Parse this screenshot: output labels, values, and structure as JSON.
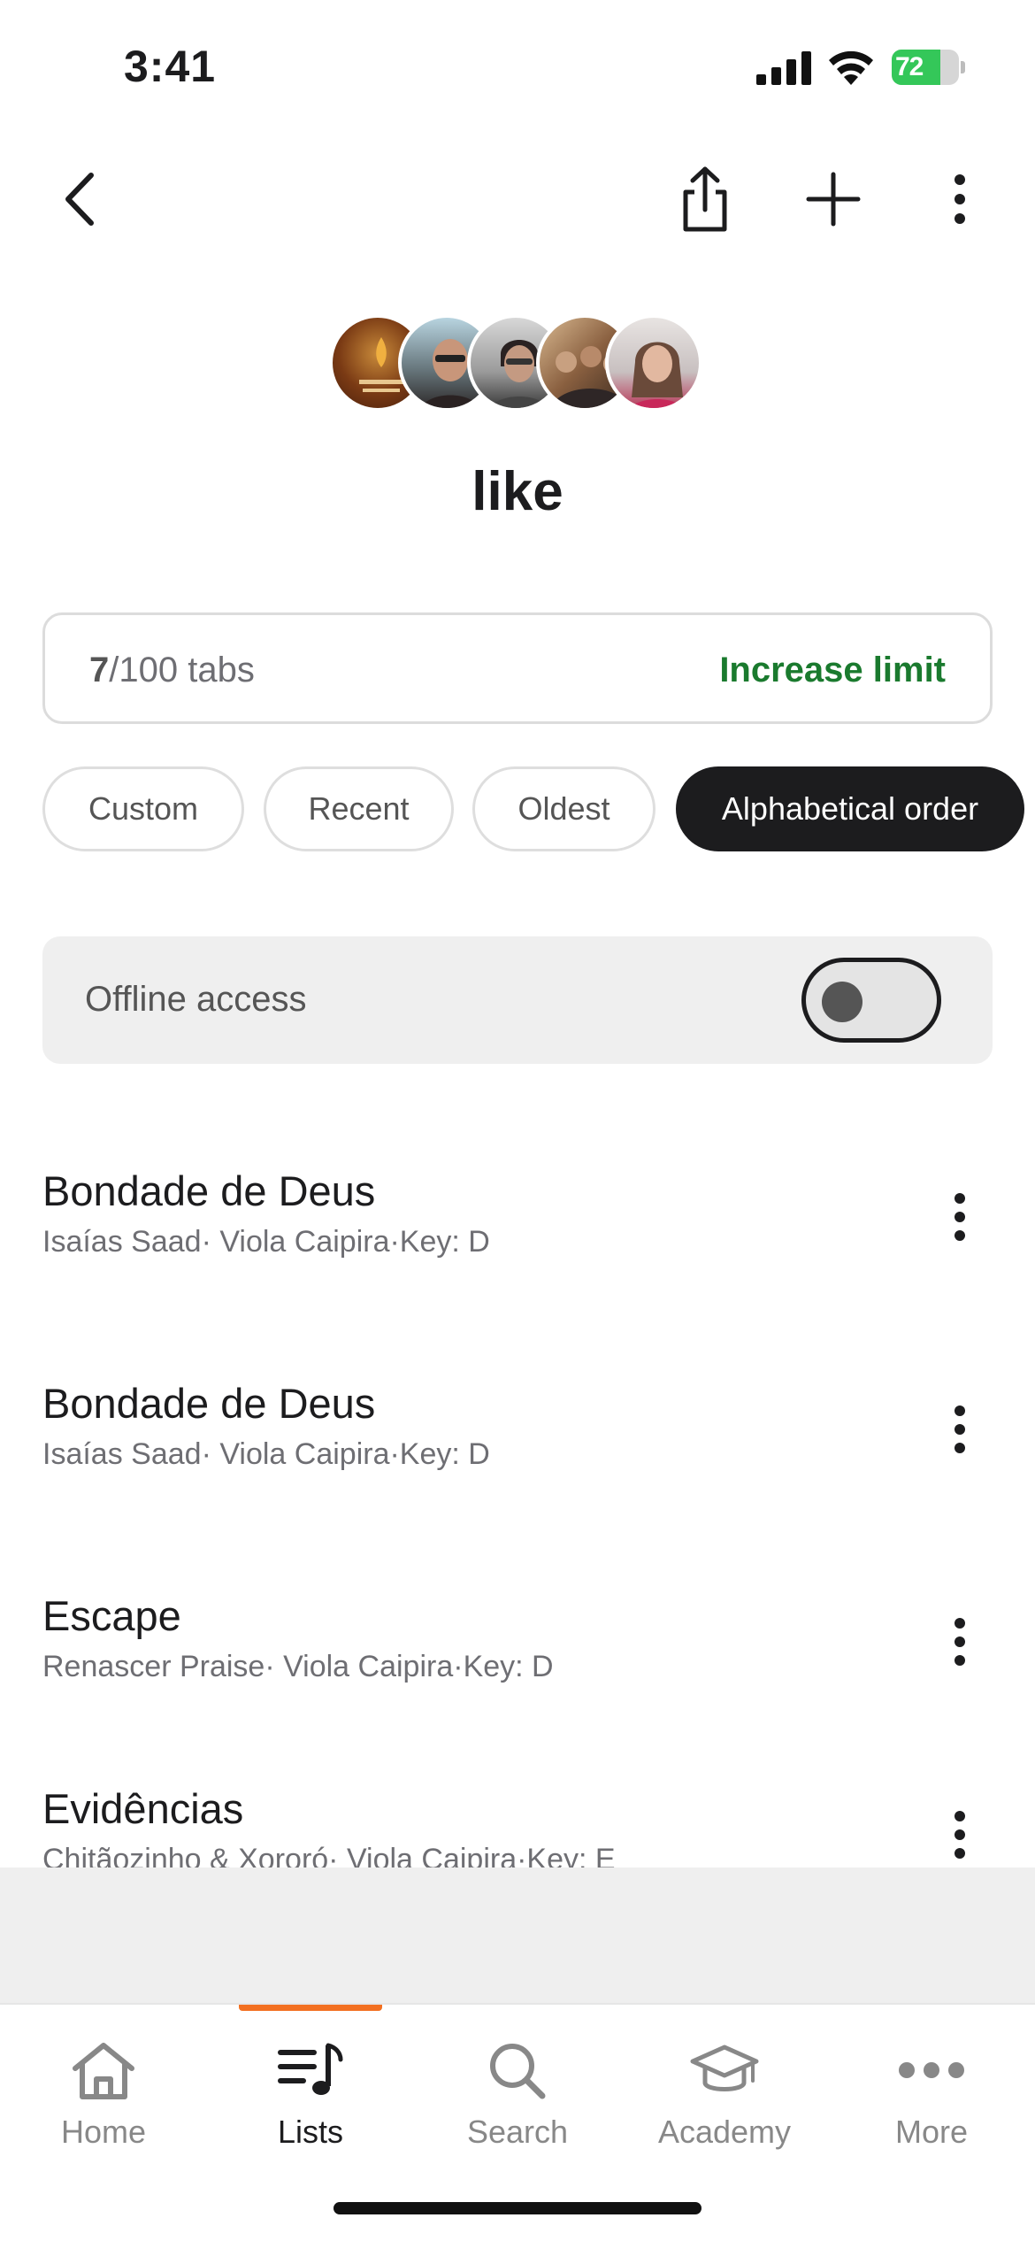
{
  "status_bar": {
    "time": "3:41",
    "battery_level": "72",
    "battery_fraction": 0.72,
    "icons": [
      "signal-icon",
      "wifi-icon",
      "battery-icon"
    ]
  },
  "top_bar": {
    "icons": [
      "back-icon",
      "share-icon",
      "add-icon",
      "more-vertical-icon"
    ]
  },
  "list": {
    "title": "like",
    "avatar_count": 5
  },
  "limit": {
    "current": "7",
    "max_suffix": "/100 tabs",
    "increase_label": "Increase limit",
    "accent_color": "#1a7a2e"
  },
  "sort_options": [
    {
      "label": "Custom",
      "selected": false
    },
    {
      "label": "Recent",
      "selected": false
    },
    {
      "label": "Oldest",
      "selected": false
    },
    {
      "label": "Alphabetical order",
      "selected": true
    }
  ],
  "offline": {
    "label": "Offline access",
    "enabled": false
  },
  "songs": [
    {
      "title": "Bondade de Deus",
      "meta": "Isaías Saad· Viola Caipira·Key: D"
    },
    {
      "title": "Bondade de Deus",
      "meta": "Isaías Saad· Viola Caipira·Key: D"
    },
    {
      "title": "Escape",
      "meta": "Renascer Praise· Viola Caipira·Key: D"
    },
    {
      "title": "Evidências",
      "meta": "Chitãozinho & Xororó· Viola Caipira·Key: E"
    }
  ],
  "tabs": [
    {
      "label": "Home",
      "icon": "home-icon",
      "active": false
    },
    {
      "label": "Lists",
      "icon": "lists-icon",
      "active": true
    },
    {
      "label": "Search",
      "icon": "search-icon",
      "active": false
    },
    {
      "label": "Academy",
      "icon": "academy-icon",
      "active": false
    },
    {
      "label": "More",
      "icon": "more-horizontal-icon",
      "active": false
    }
  ],
  "colors": {
    "active_tab_indicator": "#f37021",
    "selected_chip": "#1c1c1e"
  }
}
